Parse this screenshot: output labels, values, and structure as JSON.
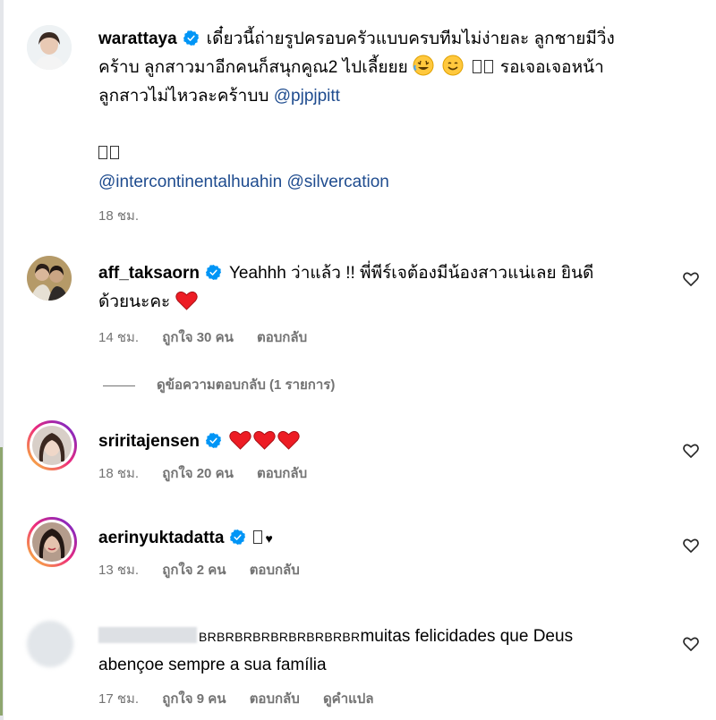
{
  "comments": [
    {
      "username": "warattaya",
      "verified": true,
      "text_line1": "เดี๋ยวนี้ถ่ายรูปครอบครัวแบบครบทีมไม่ง่ายละ ลูกชายมีวิ่ง",
      "text_line2_a": "คร้าบ ลูกสาวมาอีกคนก็สนุกคูณ2 ไปเลี้ยยย",
      "text_line2_b": "รอเจอเจอหน้า",
      "text_line3": "ลูกสาวไม่ไหวละคร้าบบ",
      "mention1": "@pjpjpitt",
      "mention2": "@intercontinentalhuahin",
      "mention3": "@silvercation",
      "time": "18 ชม."
    },
    {
      "username": "aff_taksaorn",
      "verified": true,
      "text_line1": "Yeahhh ว่าแล้ว !! พี่พีร์เจต้องมีน้องสาวแน่เลย ยินดี",
      "text_line2": "ด้วยนะคะ",
      "time": "14 ชม.",
      "likes": "ถูกใจ 30 คน",
      "reply": "ตอบกลับ"
    },
    {
      "username": "sriritajensen",
      "verified": true,
      "time": "18 ชม.",
      "likes": "ถูกใจ 20 คน",
      "reply": "ตอบกลับ"
    },
    {
      "username": "aerinyuktadatta",
      "verified": true,
      "text": "♥",
      "time": "13 ชม.",
      "likes": "ถูกใจ 2 คน",
      "reply": "ตอบกลับ"
    },
    {
      "prefix": "BRBRBRBRBRBRBRBRBR",
      "text_line1": "muitas felicidades que Deus",
      "text_line2": "abençoe sempre a sua família",
      "time": "17 ชม.",
      "likes": "ถูกใจ 9 คน",
      "reply": "ตอบกลับ",
      "translate": "ดูคำแปล"
    }
  ],
  "view_replies": "ดูข้อความตอบกลับ (1 รายการ)",
  "colors": {
    "verified": "#0095f6",
    "heart": "#ed1c24",
    "mention": "#1f4c8f",
    "meta": "#737373"
  }
}
